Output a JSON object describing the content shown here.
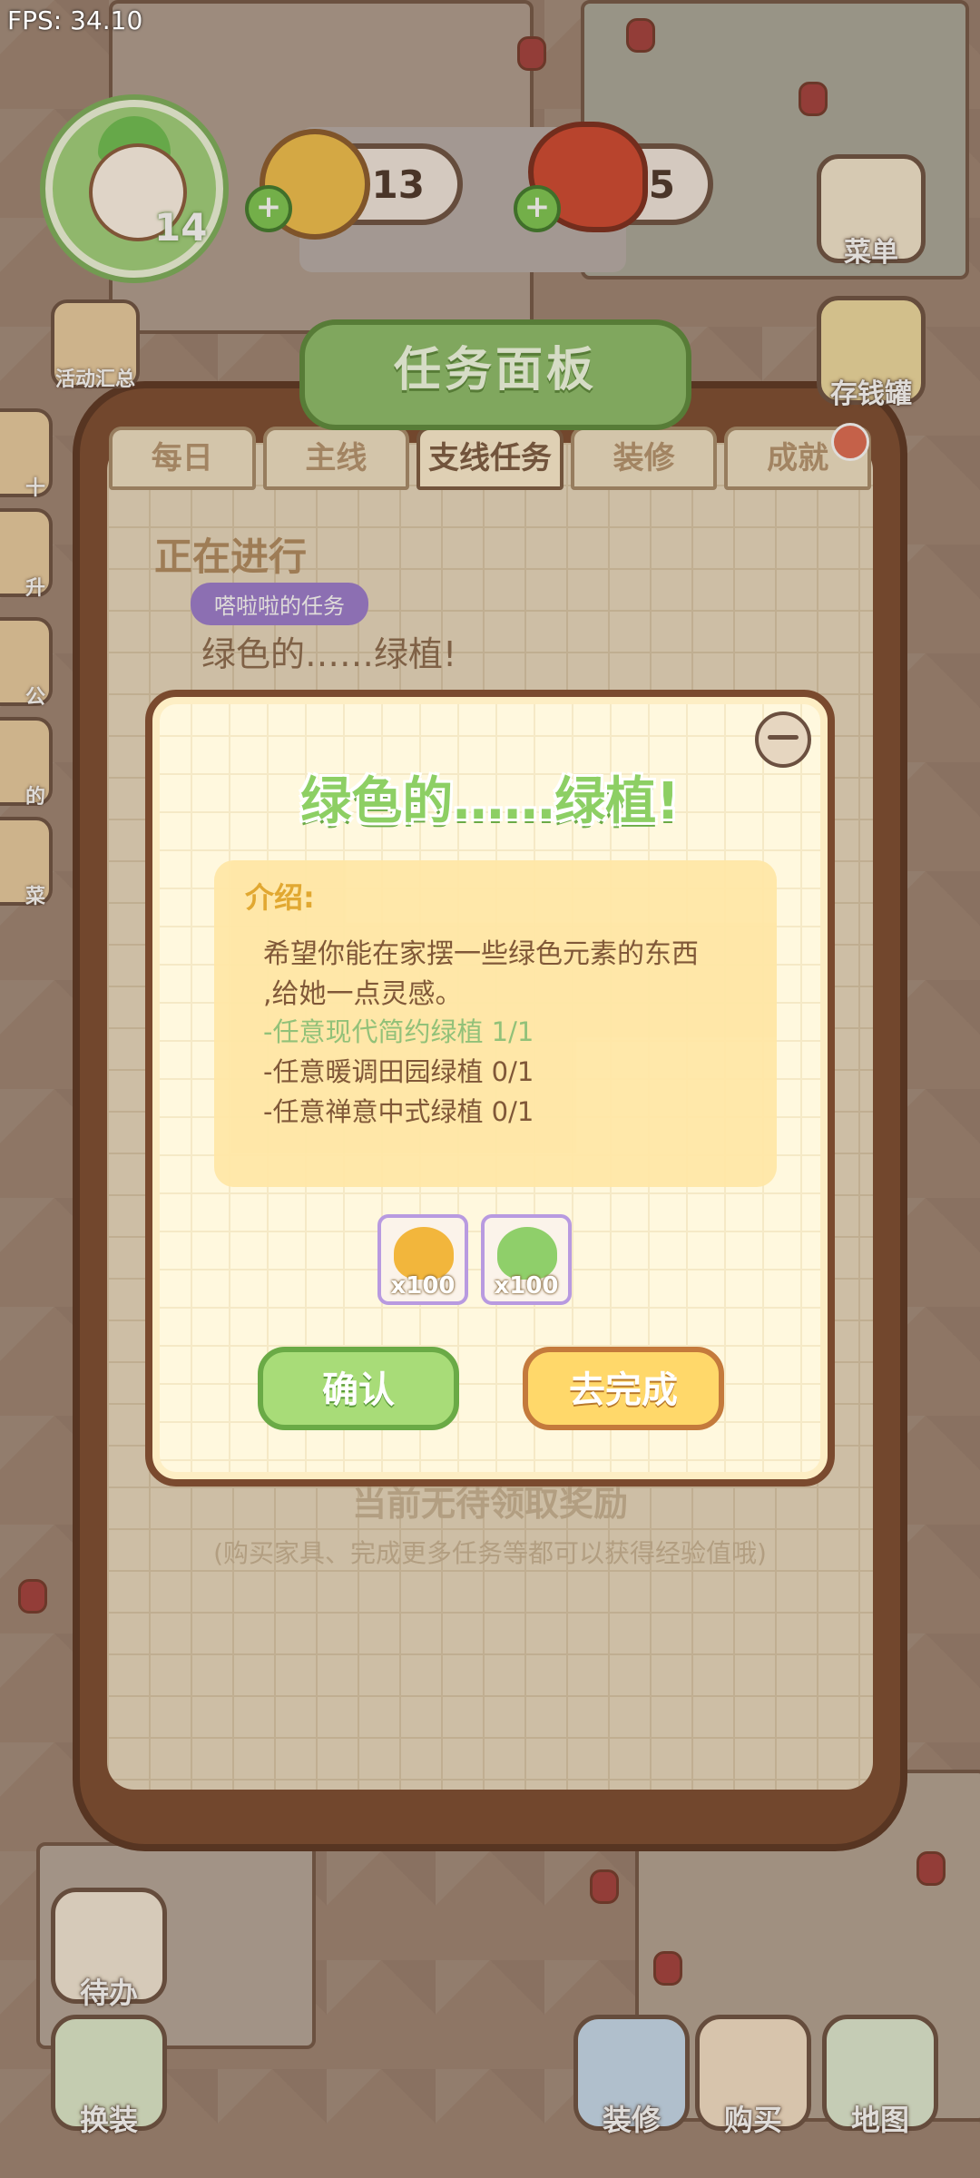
{
  "fps": "FPS: 34.10",
  "player": {
    "level": "14"
  },
  "currencies": {
    "coins": "3013",
    "food": "635"
  },
  "side_buttons": {
    "menu": "菜单",
    "piggy": "存钱罐"
  },
  "left_buttons": [
    "活动汇总",
    "十",
    "升",
    "公",
    "的",
    "菜"
  ],
  "panel": {
    "title": "任务面板",
    "tabs": [
      "每日",
      "主线",
      "支线任务",
      "装修",
      "成就"
    ],
    "active_tab": "支线任务",
    "section_heading": "正在进行",
    "task_tag": "嗒啦啦的任务",
    "task_title": "绿色的……绿植!",
    "empty_message": "当前无待领取奖励",
    "empty_hint": "(购买家具、完成更多任务等都可以获得经验值哦)"
  },
  "dialog": {
    "title": "绿色的……绿植!",
    "intro_label": "介绍:",
    "intro_line1": "希望你能在家摆一些绿色元素的东西",
    "intro_line2": ",给她一点灵感。",
    "requirements": [
      {
        "text": "-任意现代简约绿植 1/1",
        "done": true
      },
      {
        "text": "-任意暖调田园绿植 0/1",
        "done": false
      },
      {
        "text": "-任意禅意中式绿植 0/1",
        "done": false
      }
    ],
    "rewards": [
      {
        "icon": "gold-pile-icon",
        "count": "x100",
        "color": "#f2b63c"
      },
      {
        "icon": "exp-leaf-icon",
        "count": "x100",
        "color": "#8fcf6a"
      }
    ],
    "confirm_label": "确认",
    "go_label": "去完成"
  },
  "bottom_bar": {
    "todo": "待办",
    "dress": "换装",
    "decorate": "装修",
    "buy": "购买",
    "map": "地图"
  }
}
